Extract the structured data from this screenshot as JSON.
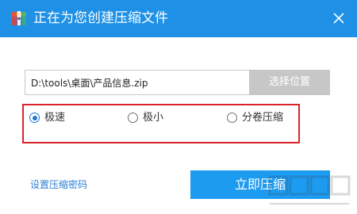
{
  "window": {
    "title": "正在为您创建压缩文件",
    "accent_color": "#1e90e6"
  },
  "path": {
    "value": "D:\\tools\\桌面\\产品信息.zip",
    "choose_label": "选择位置"
  },
  "options": [
    {
      "label": "极速",
      "checked": true
    },
    {
      "label": "极小",
      "checked": false
    },
    {
      "label": "分卷压缩",
      "checked": false
    }
  ],
  "footer": {
    "password_link": "设置压缩密码",
    "compress_label": "立即压缩"
  },
  "icons": {
    "app": "archive-box-icon",
    "close": "close-icon"
  },
  "highlight_color": "#d9232a"
}
